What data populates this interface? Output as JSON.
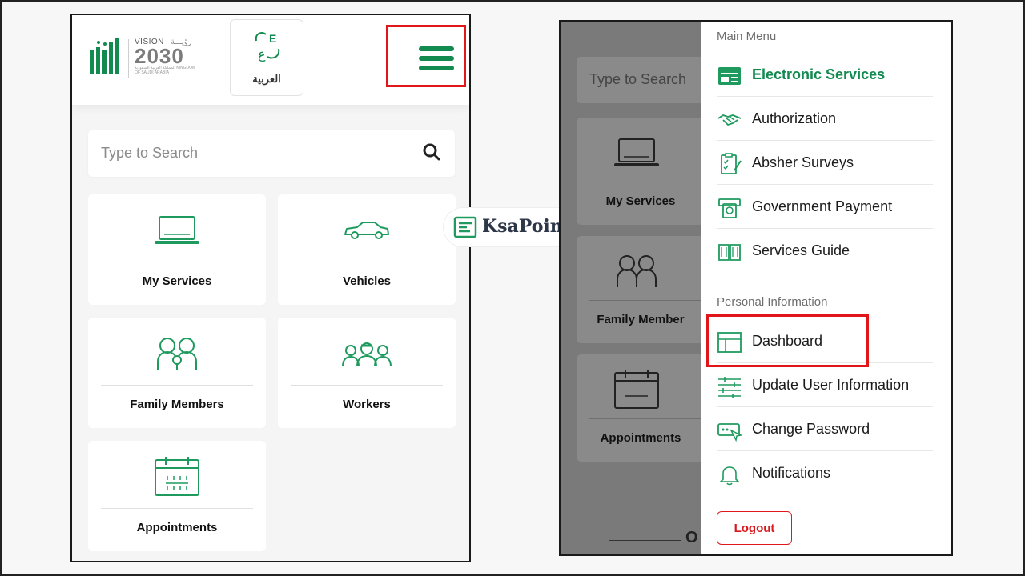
{
  "left_screen": {
    "header": {
      "vision_label": "VISION",
      "vision_arabic": "رؤيـــة",
      "vision_year": "2030",
      "vision_kingdom": "المملكة العربية السعودية KINGDOM OF SAUDI ARABIA",
      "language_label": "العربية"
    },
    "search": {
      "placeholder": "Type to Search"
    },
    "cards": [
      {
        "label": "My Services",
        "icon": "laptop-icon"
      },
      {
        "label": "Vehicles",
        "icon": "car-icon"
      },
      {
        "label": "Family Members",
        "icon": "family-icon"
      },
      {
        "label": "Workers",
        "icon": "workers-icon"
      },
      {
        "label": "Appointments",
        "icon": "calendar-icon"
      }
    ]
  },
  "brand": {
    "name": "KsaPoint"
  },
  "right_screen": {
    "background": {
      "search_placeholder": "Type to Search",
      "cards": [
        "My Services",
        "Family Member",
        "Appointments"
      ],
      "bottom_letter": "O"
    },
    "drawer": {
      "main_menu_title": "Main Menu",
      "main_items": [
        {
          "label": "Electronic Services",
          "icon": "electronic-services-icon",
          "active": true
        },
        {
          "label": "Authorization",
          "icon": "handshake-icon"
        },
        {
          "label": "Absher Surveys",
          "icon": "survey-icon"
        },
        {
          "label": "Government Payment",
          "icon": "payment-icon"
        },
        {
          "label": "Services Guide",
          "icon": "book-icon"
        }
      ],
      "personal_title": "Personal Information",
      "personal_items": [
        {
          "label": "Dashboard",
          "icon": "dashboard-icon"
        },
        {
          "label": "Update User Information",
          "icon": "sliders-icon"
        },
        {
          "label": "Change Password",
          "icon": "password-icon"
        },
        {
          "label": "Notifications",
          "icon": "bell-icon"
        }
      ],
      "logout_label": "Logout"
    }
  },
  "colors": {
    "accent": "#138a4f",
    "highlight": "#e0161b",
    "overlay": "#7a7a7a"
  }
}
